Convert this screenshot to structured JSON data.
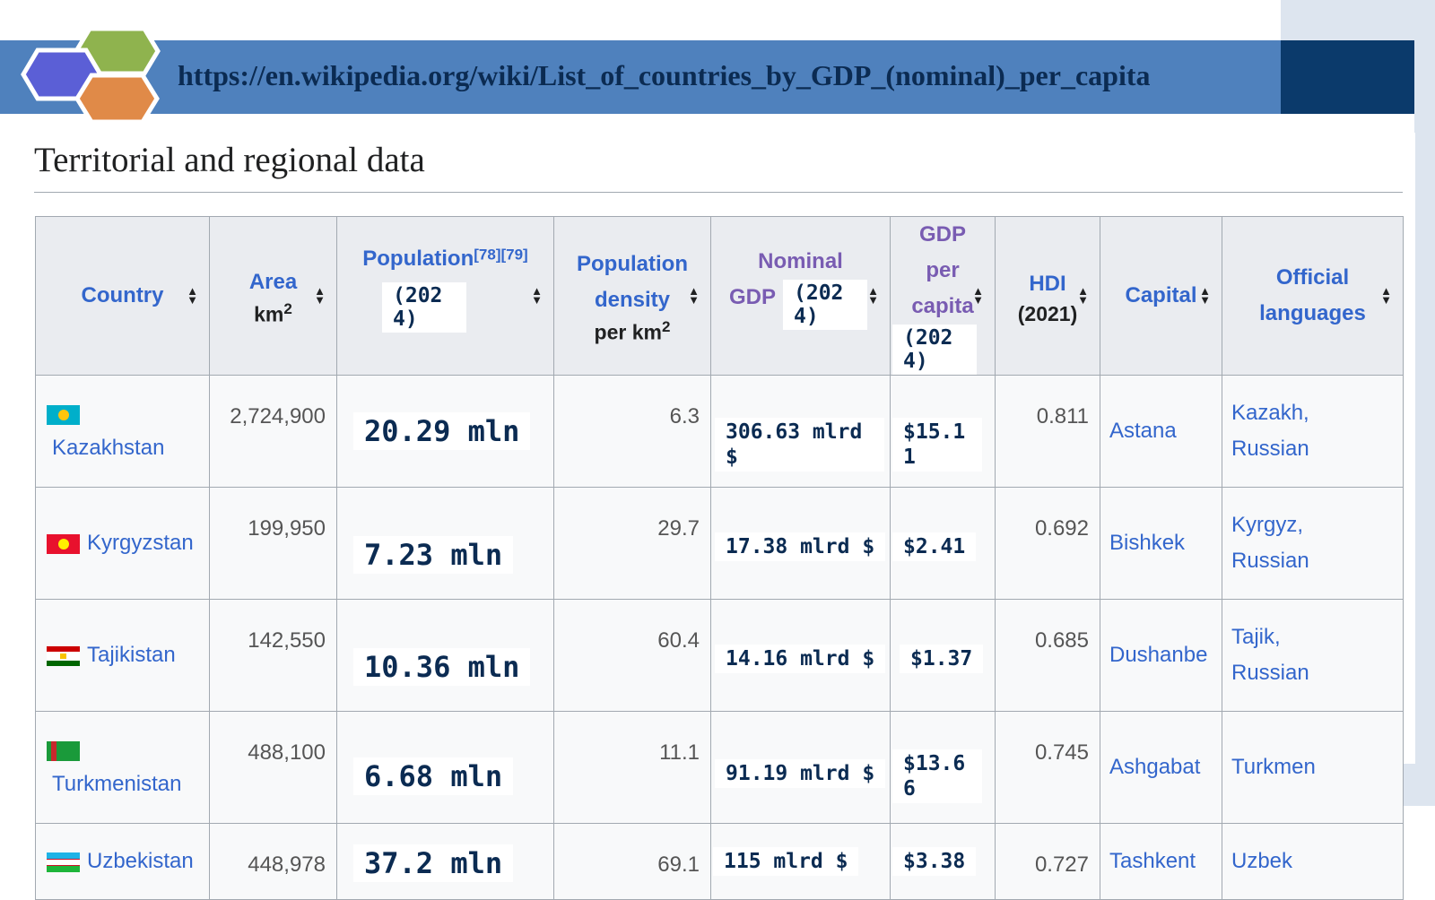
{
  "banner": {
    "url": "https://en.wikipedia.org/wiki/List_of_countries_by_GDP_(nominal)_per_capita"
  },
  "section": {
    "title": "Territorial and regional data"
  },
  "table": {
    "headers": {
      "country": "Country",
      "area": "Area",
      "area_unit": "km",
      "area_sup": "2",
      "population": "Population",
      "population_refs": "[78][79]",
      "population_year": "(2024)",
      "density_l1": "Population",
      "density_l2": "density",
      "density_unit": "per km",
      "density_sup": "2",
      "gdp_l1": "Nominal",
      "gdp_l2": "GDP",
      "gdp_year": "(2024)",
      "gdppc_l1": "GDP",
      "gdppc_l2": "per",
      "gdppc_l3": "capita",
      "gdppc_year": "(2024)",
      "hdi": "HDI",
      "hdi_year": "(2021)",
      "capital": "Capital",
      "lang_l1": "Official",
      "lang_l2": "languages"
    },
    "rows": [
      {
        "country": "Kazakhstan",
        "flag": "kazakhstan-flag-icon",
        "area": "2,724,900",
        "population": "20.29 mln",
        "density": "6.3",
        "gdp": "306.63 mlrd $",
        "gdp_per_capita": "$15.11",
        "hdi": "0.811",
        "capital": "Astana",
        "lang1": "Kazakh,",
        "lang2": "Russian"
      },
      {
        "country": "Kyrgyzstan",
        "flag": "kyrgyzstan-flag-icon",
        "area": "199,950",
        "population": "7.23 mln",
        "density": "29.7",
        "gdp": "17.38 mlrd $",
        "gdp_per_capita": "$2.41",
        "hdi": "0.692",
        "capital": "Bishkek",
        "lang1": "Kyrgyz,",
        "lang2": "Russian"
      },
      {
        "country": "Tajikistan",
        "flag": "tajikistan-flag-icon",
        "area": "142,550",
        "population": "10.36 mln",
        "density": "60.4",
        "gdp": "14.16 mlrd $",
        "gdp_per_capita": "$1.37",
        "hdi": "0.685",
        "capital": "Dushanbe",
        "lang1": "Tajik,",
        "lang2": "Russian"
      },
      {
        "country": "Turkmenistan",
        "flag": "turkmenistan-flag-icon",
        "area": "488,100",
        "population": "6.68 mln",
        "density": "11.1",
        "gdp": "91.19 mlrd $",
        "gdp_per_capita": "$13.66",
        "hdi": "0.745",
        "capital": "Ashgabat",
        "lang1": "Turkmen",
        "lang2": ""
      },
      {
        "country": "Uzbekistan",
        "flag": "uzbekistan-flag-icon",
        "area": "448,978",
        "population": "37.2 mln",
        "density": "69.1",
        "gdp": "115 mlrd $",
        "gdp_per_capita": "$3.38",
        "hdi": "0.727",
        "capital": "Tashkent",
        "lang1": "Uzbek",
        "lang2": ""
      }
    ]
  },
  "colors": {
    "banner": "#4f81bd",
    "banner_dark": "#0b3a6b",
    "link": "#3366cc",
    "visited_link": "#795cb2",
    "header_bg": "#eaecf0",
    "cell_bg": "#f8f9fa",
    "overlay_text": "#0b2b52"
  }
}
